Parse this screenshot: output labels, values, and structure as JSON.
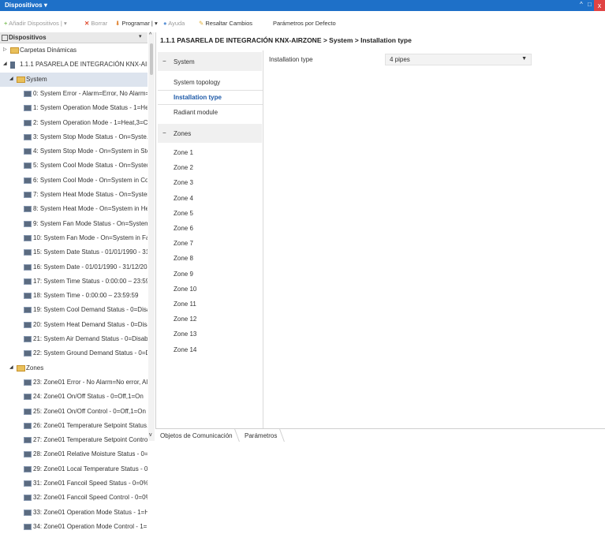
{
  "window": {
    "title": "Dispositivos",
    "title_caret": "▾",
    "controls": [
      "^",
      "□",
      "x"
    ]
  },
  "toolbar": {
    "add": "Añadir Dispositivos",
    "add_caret": "▾",
    "delete": "Borrar",
    "program": "Programar",
    "program_caret": "▾",
    "help": "Ayuda",
    "highlight": "Resaltar Cambios",
    "defaults": "Parámetros por Defecto"
  },
  "left_panel": {
    "header": "Dispositivos",
    "tree": [
      {
        "label": "Carpetas Dinámicas",
        "icon": "folder-icon",
        "level": 1
      },
      {
        "label": "1.1.1 PASARELA DE INTEGRACIÓN KNX-AIR...",
        "icon": "device-icon",
        "level": 1
      },
      {
        "label": "System",
        "icon": "folder-icon",
        "level": 2
      },
      {
        "label": "0: System Error - Alarm=Error, No Alarm=...",
        "icon": "object-icon",
        "level": 3
      },
      {
        "label": "1: System Operation Mode Status - 1=He...",
        "icon": "object-icon",
        "level": 3
      },
      {
        "label": "2: System Operation Mode  - 1=Heat,3=C...",
        "icon": "object-icon",
        "level": 3
      },
      {
        "label": "3: System Stop Mode Status  - On=Syste...",
        "icon": "object-icon",
        "level": 3
      },
      {
        "label": "4: System Stop Mode - On=System in Sto...",
        "icon": "object-icon",
        "level": 3
      },
      {
        "label": "5: System Cool Mode Status - On=System...",
        "icon": "object-icon",
        "level": 3
      },
      {
        "label": "6: System Cool Mode - On=System in Co...",
        "icon": "object-icon",
        "level": 3
      },
      {
        "label": "7: System Heat Mode Status - On=System...",
        "icon": "object-icon",
        "level": 3
      },
      {
        "label": "8: System Heat Mode - On=System in He...",
        "icon": "object-icon",
        "level": 3
      },
      {
        "label": "9: System Fan Mode Status - On=System i...",
        "icon": "object-icon",
        "level": 3
      },
      {
        "label": "10: System Fan Mode  - On=System in Fa...",
        "icon": "object-icon",
        "level": 3
      },
      {
        "label": "15: System Date Status - 01/01/1990 - 31/...",
        "icon": "object-icon",
        "level": 3
      },
      {
        "label": "16: System Date - 01/01/1990 - 31/12/2089",
        "icon": "object-icon",
        "level": 3
      },
      {
        "label": "17: System Time Status - 0:00:00 – 23:59:59",
        "icon": "object-icon",
        "level": 3
      },
      {
        "label": "18: System Time  - 0:00:00 – 23:59:59",
        "icon": "object-icon",
        "level": 3
      },
      {
        "label": "19: System Cool Demand Status - 0=Disa...",
        "icon": "object-icon",
        "level": 3
      },
      {
        "label": "20: System Heat Demand Status - 0=Disa...",
        "icon": "object-icon",
        "level": 3
      },
      {
        "label": "21: System Air Demand Status - 0=Disabl...",
        "icon": "object-icon",
        "level": 3
      },
      {
        "label": "22: System Ground Demand Status - 0=Di...",
        "icon": "object-icon",
        "level": 3
      },
      {
        "label": "Zones",
        "icon": "folder-icon",
        "level": 2
      },
      {
        "label": "23: Zone01 Error - No Alarm=No error, Al...",
        "icon": "object-icon",
        "level": 3
      },
      {
        "label": "24: Zone01 On/Off Status - 0=Off,1=On",
        "icon": "object-icon",
        "level": 3
      },
      {
        "label": "25: Zone01 On/Off Control - 0=Off,1=On",
        "icon": "object-icon",
        "level": 3
      },
      {
        "label": "26: Zone01 Temperature Setpoint  Status...",
        "icon": "object-icon",
        "level": 3
      },
      {
        "label": "27: Zone01 Temperature Setpoint Control...",
        "icon": "object-icon",
        "level": 3
      },
      {
        "label": "28: Zone01 Relative Moisture Status - 0=0...",
        "icon": "object-icon",
        "level": 3
      },
      {
        "label": "29: Zone01 Local Temperature Status - 0=...",
        "icon": "object-icon",
        "level": 3
      },
      {
        "label": "31: Zone01 Fancoil Speed Status - 0=0%=...",
        "icon": "object-icon",
        "level": 3
      },
      {
        "label": "32: Zone01 Fancoil Speed Control - 0=0%...",
        "icon": "object-icon",
        "level": 3
      },
      {
        "label": "33: Zone01 Operation Mode Status - 1=H...",
        "icon": "object-icon",
        "level": 3
      },
      {
        "label": "34: Zone01 Operation Mode Control - 1=...",
        "icon": "object-icon",
        "level": 3
      }
    ]
  },
  "breadcrumb": "1.1.1 PASARELA DE INTEGRACIÓN KNX-AIRZONE > System > Installation type",
  "nav": {
    "system_section": "System",
    "system_items": [
      "System topology",
      "Installation type",
      "Radiant module"
    ],
    "zones_section": "Zones",
    "zone_items": [
      "Zone 1",
      "Zone 2",
      "Zone 3",
      "Zone 4",
      "Zone 5",
      "Zone 6",
      "Zone 7",
      "Zone 8",
      "Zone 9",
      "Zone 10",
      "Zone 11",
      "Zone 12",
      "Zone 13",
      "Zone 14"
    ],
    "active": "Installation type",
    "section_marker": "−"
  },
  "param": {
    "label": "Installation type",
    "value": "4 pipes"
  },
  "bottom_tabs": {
    "tab1": "Objetos de Comunicación",
    "tab2": "Parámetros",
    "active": "Parámetros"
  },
  "colors": {
    "titlebar": "#1e70c8",
    "active_nav": "#1e5aa8",
    "close": "#e04343"
  }
}
